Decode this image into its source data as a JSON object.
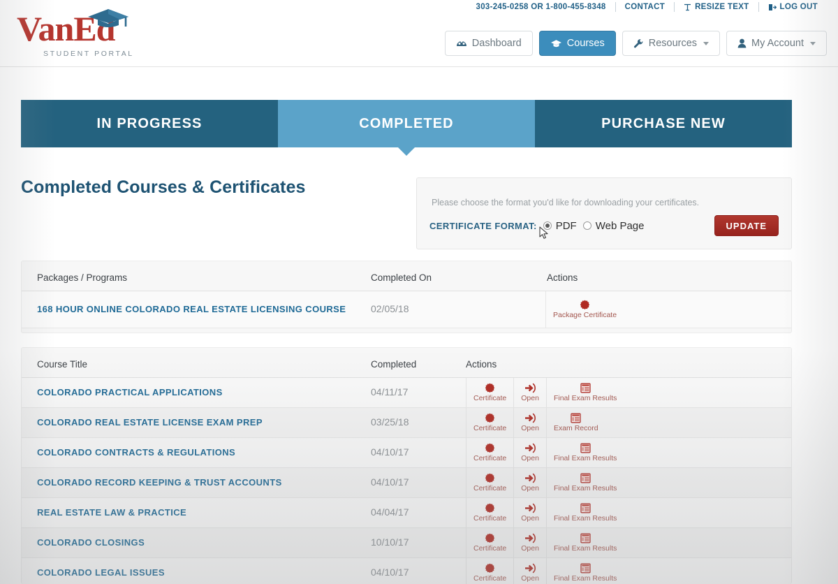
{
  "brand": {
    "logo_text": "VanEd",
    "logo_sub": "STUDENT PORTAL",
    "logo_color": "#b5352e",
    "cap_color": "#2e6b8f"
  },
  "utility_bar": {
    "phone": "303-245-0258 OR 1-800-455-8348",
    "contact": "CONTACT",
    "resize_text": "RESIZE TEXT",
    "log_out": "LOG OUT"
  },
  "nav": {
    "items": [
      {
        "label": "Dashboard",
        "icon": "dashboard-icon",
        "active": false,
        "caret": false
      },
      {
        "label": "Courses",
        "icon": "graduation-cap-icon",
        "active": true,
        "caret": false
      },
      {
        "label": "Resources",
        "icon": "wrench-icon",
        "active": false,
        "caret": true
      },
      {
        "label": "My Account",
        "icon": "user-icon",
        "active": false,
        "caret": true
      }
    ]
  },
  "tabs": [
    {
      "label": "IN PROGRESS",
      "active": false
    },
    {
      "label": "COMPLETED",
      "active": true
    },
    {
      "label": "PURCHASE NEW",
      "active": false
    }
  ],
  "page": {
    "title": "Completed Courses & Certificates"
  },
  "cert_format": {
    "note": "Please choose the format you'd like for downloading your certificates.",
    "label": "CERTIFICATE FORMAT:",
    "options": [
      {
        "label": "PDF",
        "selected": true
      },
      {
        "label": "Web Page",
        "selected": false
      }
    ],
    "update_label": "UPDATE",
    "update_color": "#a02b23"
  },
  "packages_table": {
    "headers": [
      "Packages / Programs",
      "Completed On",
      "Actions"
    ],
    "rows": [
      {
        "title": "168 HOUR ONLINE COLORADO REAL ESTATE LICENSING COURSE",
        "date": "02/05/18",
        "actions": [
          {
            "label": "Package Certificate",
            "icon": "certificate-seal-icon"
          }
        ]
      }
    ]
  },
  "courses_table": {
    "headers": [
      "Course Title",
      "Completed",
      "Actions"
    ],
    "rows": [
      {
        "title": "COLORADO PRACTICAL APPLICATIONS",
        "date": "04/11/17",
        "actions": [
          {
            "label": "Certificate",
            "icon": "certificate-seal-icon"
          },
          {
            "label": "Open",
            "icon": "open-arrow-icon"
          },
          {
            "label": "Final Exam Results",
            "icon": "exam-document-icon"
          }
        ]
      },
      {
        "title": "COLORADO REAL ESTATE LICENSE EXAM PREP",
        "date": "03/25/18",
        "actions": [
          {
            "label": "Certificate",
            "icon": "certificate-seal-icon"
          },
          {
            "label": "Open",
            "icon": "open-arrow-icon"
          },
          {
            "label": "Exam Record",
            "icon": "exam-document-icon"
          }
        ]
      },
      {
        "title": "COLORADO CONTRACTS & REGULATIONS",
        "date": "04/10/17",
        "actions": [
          {
            "label": "Certificate",
            "icon": "certificate-seal-icon"
          },
          {
            "label": "Open",
            "icon": "open-arrow-icon"
          },
          {
            "label": "Final Exam Results",
            "icon": "exam-document-icon"
          }
        ]
      },
      {
        "title": "COLORADO RECORD KEEPING & TRUST ACCOUNTS",
        "date": "04/10/17",
        "actions": [
          {
            "label": "Certificate",
            "icon": "certificate-seal-icon"
          },
          {
            "label": "Open",
            "icon": "open-arrow-icon"
          },
          {
            "label": "Final Exam Results",
            "icon": "exam-document-icon"
          }
        ]
      },
      {
        "title": "REAL ESTATE LAW & PRACTICE",
        "date": "04/04/17",
        "actions": [
          {
            "label": "Certificate",
            "icon": "certificate-seal-icon"
          },
          {
            "label": "Open",
            "icon": "open-arrow-icon"
          },
          {
            "label": "Final Exam Results",
            "icon": "exam-document-icon"
          }
        ]
      },
      {
        "title": "COLORADO CLOSINGS",
        "date": "10/10/17",
        "actions": [
          {
            "label": "Certificate",
            "icon": "certificate-seal-icon"
          },
          {
            "label": "Open",
            "icon": "open-arrow-icon"
          },
          {
            "label": "Final Exam Results",
            "icon": "exam-document-icon"
          }
        ]
      },
      {
        "title": "COLORADO LEGAL ISSUES",
        "date": "04/10/17",
        "actions": [
          {
            "label": "Certificate",
            "icon": "certificate-seal-icon"
          },
          {
            "label": "Open",
            "icon": "open-arrow-icon"
          },
          {
            "label": "Final Exam Results",
            "icon": "exam-document-icon"
          }
        ]
      }
    ]
  },
  "colors": {
    "tab_active": "#5ba3c9",
    "tab_inactive": "#24627f",
    "nav_active": "#3c8dbc",
    "link_blue": "#1f6a96",
    "title_blue": "#1d5272",
    "action_red": "#a3564e",
    "seal_red": "#b02a22"
  }
}
